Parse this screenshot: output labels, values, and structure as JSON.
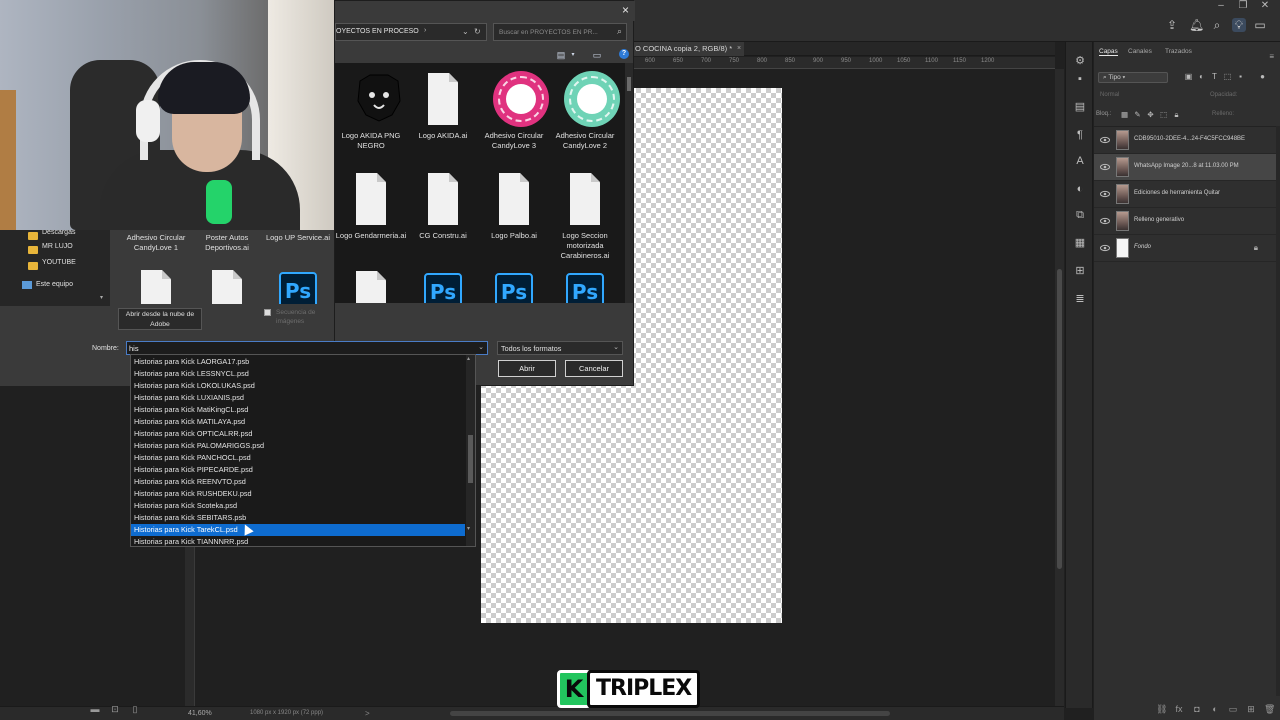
{
  "photoshop": {
    "doc_tab": "O COCINA copia 2, RGB/8) *",
    "doc_tab_close": "×",
    "ruler_marks": [
      "600",
      "650",
      "700",
      "750",
      "800",
      "850",
      "900",
      "950",
      "1000",
      "1050",
      "1100",
      "1150",
      "1200"
    ],
    "status_zoom": "41,60%",
    "status_size": "1080 px x 1920 px (72 ppp)",
    "status_arrow": ">"
  },
  "layers_panel": {
    "tabs": [
      "Capas",
      "Canales",
      "Trazados"
    ],
    "filter_kind": "Tipo",
    "blend_mode": "Normal",
    "opacity_label": "Opacidad:",
    "lock_label": "Bloq.:",
    "fill_label": "Relleno:",
    "layers": [
      {
        "name": "CDB95010-2DEE-4...24-F4C5FCC948BE",
        "thumb": "photo",
        "selected": false,
        "italic": false,
        "locked": false
      },
      {
        "name": "WhatsApp Image 20...8 at 11.03.00 PM",
        "thumb": "photo",
        "selected": true,
        "italic": false,
        "locked": false
      },
      {
        "name": "Ediciones de herramienta Quitar",
        "thumb": "photo",
        "selected": false,
        "italic": false,
        "locked": false
      },
      {
        "name": "Relleno generativo",
        "thumb": "photo",
        "selected": false,
        "italic": false,
        "locked": false
      },
      {
        "name": "Fondo",
        "thumb": "white",
        "selected": false,
        "italic": true,
        "locked": true
      }
    ]
  },
  "dialog": {
    "close": "×",
    "path": "OYECTOS EN PROCESO",
    "path_arrow": "›",
    "search_placeholder": "Buscar en PROYECTOS EN PR...",
    "help": "?",
    "files_row1": [
      {
        "label": "Logo AKIDA PNG NEGRO",
        "kind": "dog"
      },
      {
        "label": "Logo AKIDA.ai",
        "kind": "doc"
      },
      {
        "label": "Adhesivo Circular CandyLove 3",
        "kind": "badge-pink"
      },
      {
        "label": "Adhesivo Circular CandyLove 2",
        "kind": "badge-mint"
      }
    ],
    "files_row2": [
      {
        "label": "Adhesivo Circular CandyLove 1",
        "kind": "hidden"
      },
      {
        "label": "Poster Autos Deportivos.ai",
        "kind": "hidden"
      },
      {
        "label": "Logo UP Service.ai",
        "kind": "hidden"
      },
      {
        "label": "Logo Gendarmeria.ai",
        "kind": "doc"
      },
      {
        "label": "CG Constru.ai",
        "kind": "doc"
      },
      {
        "label": "Logo Palbo.ai",
        "kind": "doc"
      },
      {
        "label": "Logo Seccion motorizada Carabineros.ai",
        "kind": "doc"
      }
    ],
    "files_row3": [
      "doc",
      "doc",
      "ps",
      "doc",
      "ps",
      "ps",
      "ps"
    ],
    "ps_glyph": "Ps",
    "cloud_button": "Abrir desde la nube de Adobe",
    "sequence_label": "Secuencia de imágenes",
    "name_label": "Nombre:",
    "name_value": "his",
    "format_value": "Todos los formatos",
    "open_button": "Abrir",
    "cancel_button": "Cancelar"
  },
  "nav_sidebar": {
    "items": [
      "Descargas",
      "MR LUJO",
      "YOUTUBE"
    ],
    "this_pc": "Este equipo"
  },
  "autocomplete": {
    "items": [
      "Historias para Kick LAORGA17.psb",
      "Historias para Kick LESSNYCL.psd",
      "Historias para Kick LOKOLUKAS.psd",
      "Historias para Kick LUXIANIS.psd",
      "Historias para Kick MatiKingCL.psd",
      "Historias para Kick MATILAYA.psd",
      "Historias para Kick OPTICALRR.psd",
      "Historias para Kick PALOMARIGGS.psd",
      "Historias para Kick PANCHOCL.psd",
      "Historias para Kick PIPECARDE.psd",
      "Historias para Kick REENVTO.psd",
      "Historias para Kick RUSHDEKU.psd",
      "Historias para Kick Scoteka.psd",
      "Historias para Kick SEBITARS.psb",
      "Historias para Kick TarekCL.psd",
      "Historias para Kick TIANNNRR.psd"
    ],
    "selected_index": 14
  },
  "watermark": {
    "k": "K",
    "text": "TRIPLEX"
  },
  "colors": {
    "selection": "#0e6cd0",
    "ps_blue": "#31a8ff",
    "candy_pink": "#e0327f",
    "candy_mint": "#6fd3b6",
    "kick_green": "#22c55e"
  }
}
